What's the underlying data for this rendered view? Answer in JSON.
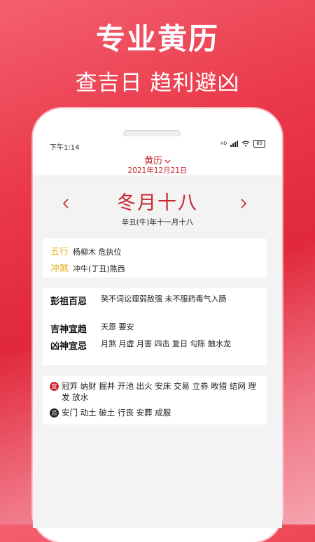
{
  "promo": {
    "title": "专业黄历",
    "subtitle": "查吉日 趋利避凶"
  },
  "status_bar": {
    "time": "下午1:14",
    "signal": "HD",
    "battery": "80"
  },
  "header": {
    "title": "黄历",
    "date": "2021年12月21日"
  },
  "date_panel": {
    "lunar_date": "冬月十八",
    "ganzhi_date": "辛丑(牛)年十一月十八"
  },
  "wuxing_card": {
    "wuxing_label": "五行",
    "wuxing_value": "杨柳木 危执位",
    "chongsha_label": "冲煞",
    "chongsha_value": "冲牛(丁丑)煞西"
  },
  "pengzu_card": {
    "pengzu_label": "彭祖百忌",
    "pengzu_value": "癸不词讼理弱敌强 未不服药毒气入肠",
    "jishen_label": "吉神宜趋",
    "jishen_value": "天恩 要安",
    "xiongshen_label": "凶神宜忌",
    "xiongshen_value": "月煞 月虚 月害 四击 复日 勾陈 触水龙"
  },
  "yiji_card": {
    "yi_badge": "宜",
    "yi_value": "冠笄 纳财 掘井 开池 出火 安床 交易 立券 畋猎 结网 理发 放水",
    "ji_badge": "忌",
    "ji_value": "安门 动土 破土 行丧 安葬 成服"
  },
  "colors": {
    "accent": "#c8262f",
    "label_gold": "#e2b21a",
    "background_red": "#e0283a"
  }
}
